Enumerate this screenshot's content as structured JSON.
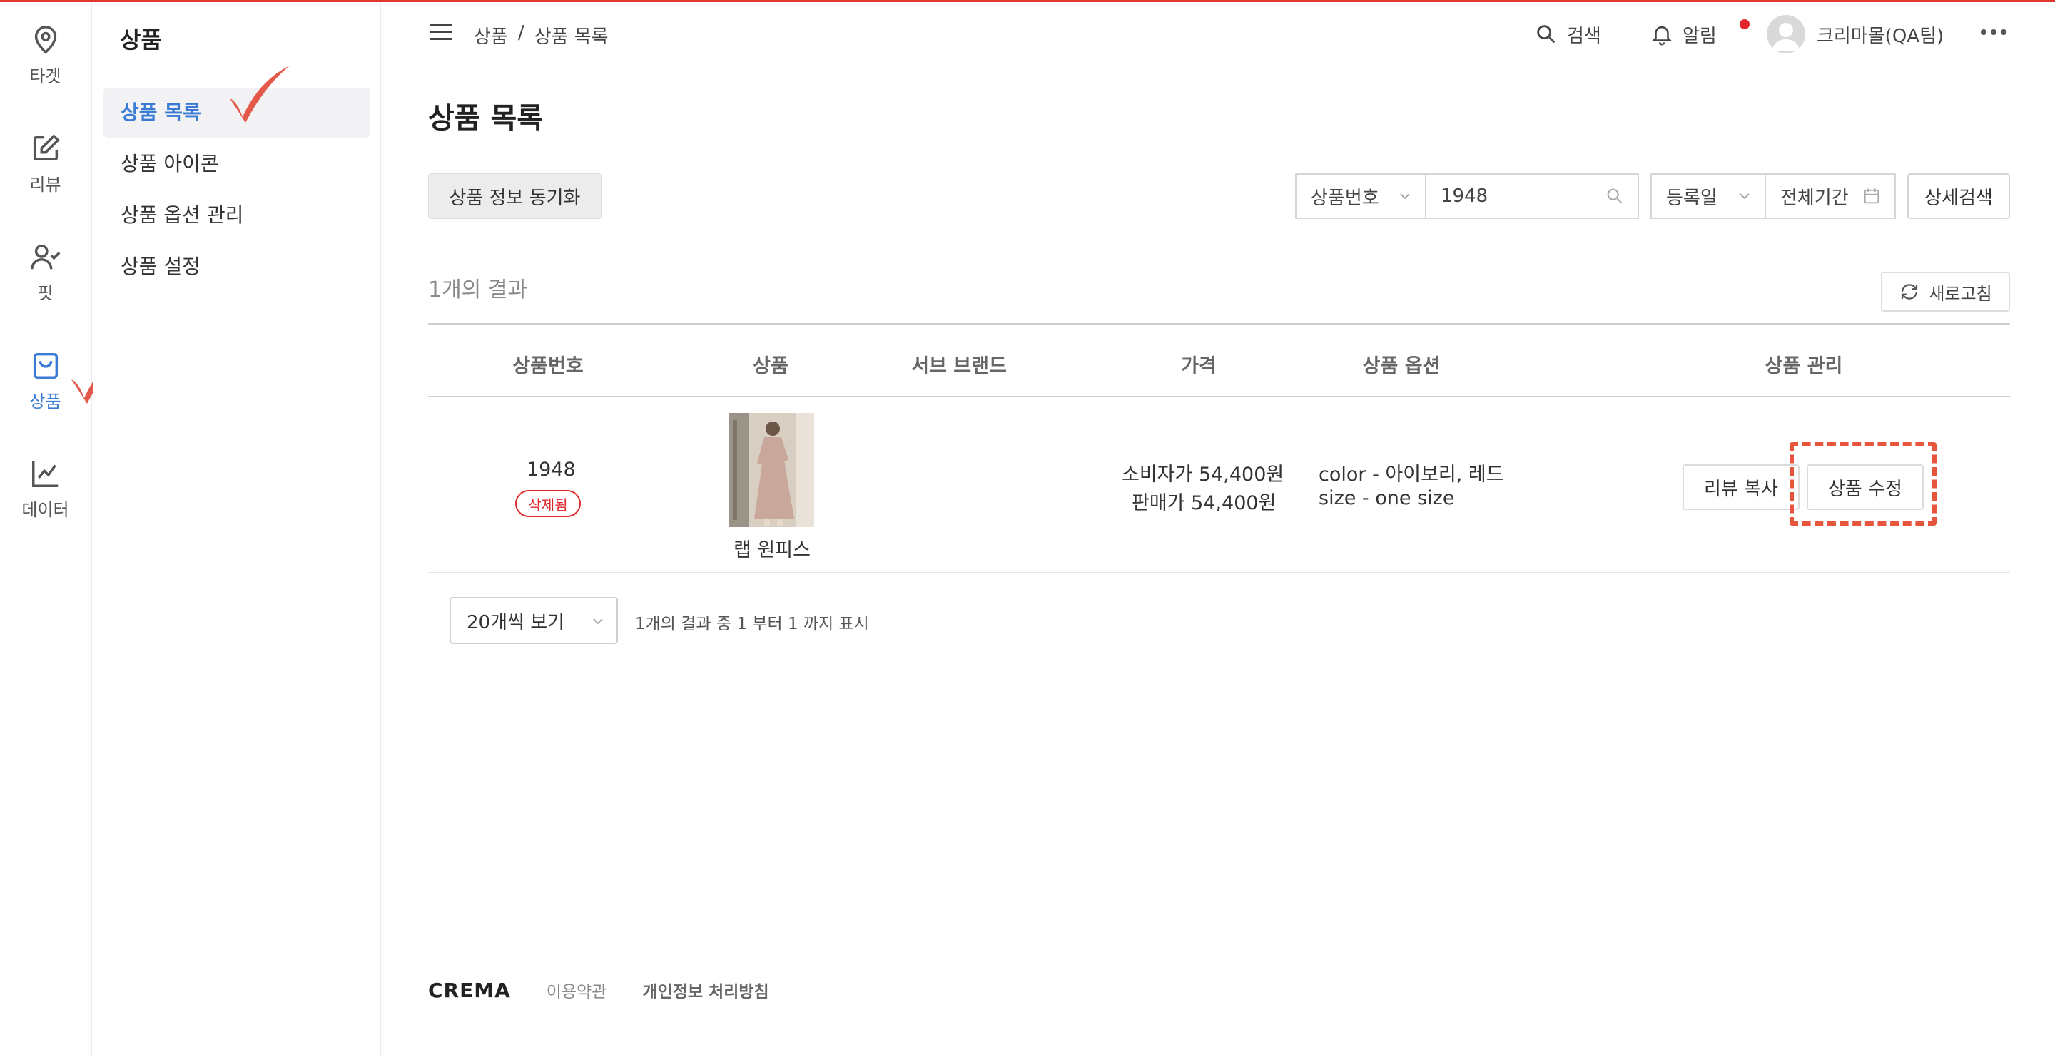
{
  "rail": [
    {
      "label": "타겟",
      "icon": "location-pin-icon"
    },
    {
      "label": "리뷰",
      "icon": "edit-icon"
    },
    {
      "label": "핏",
      "icon": "user-check-icon"
    },
    {
      "label": "상품",
      "icon": "shopping-bag-icon",
      "active": true
    },
    {
      "label": "데이터",
      "icon": "line-chart-icon"
    }
  ],
  "submenu": {
    "title": "상품",
    "items": [
      {
        "label": "상품 목록",
        "active": true
      },
      {
        "label": "상품 아이콘"
      },
      {
        "label": "상품 옵션 관리"
      },
      {
        "label": "상품 설정"
      }
    ]
  },
  "header": {
    "breadcrumb": [
      "상품",
      "/",
      "상품 목록"
    ],
    "search": "검색",
    "alerts": "알림",
    "user": "크리마몰(QA팀)"
  },
  "page": {
    "title": "상품 목록",
    "sync_button": "상품 정보 동기화",
    "search_field": "상품번호",
    "search_value": "1948",
    "date_field": "등록일",
    "date_range": "전체기간",
    "detail_search": "상세검색",
    "result_count": "1개의 결과",
    "refresh": "새로고침"
  },
  "table": {
    "columns": [
      "상품번호",
      "상품",
      "서브 브랜드",
      "가격",
      "상품 옵션",
      "상품 관리"
    ],
    "rows": [
      {
        "id": "1948",
        "status": "삭제됨",
        "name": "랩 원피스",
        "sub_brand": "",
        "price_consumer": "소비자가 54,400원",
        "price_sale": "판매가 54,400원",
        "option_color": "color - 아이보리, 레드",
        "option_size": "size - one size",
        "action_copy": "리뷰 복사",
        "action_edit": "상품 수정"
      }
    ]
  },
  "pagination": {
    "per_page": "20개씩 보기",
    "info": "1개의 결과 중 1 부터 1 까지 표시"
  },
  "footer": {
    "logo": "CREMA",
    "terms": "이용약관",
    "privacy": "개인정보 처리방침"
  },
  "colors": {
    "accent": "#3a7bd5",
    "alert": "#e0262a",
    "highlight": "#e8553d"
  }
}
